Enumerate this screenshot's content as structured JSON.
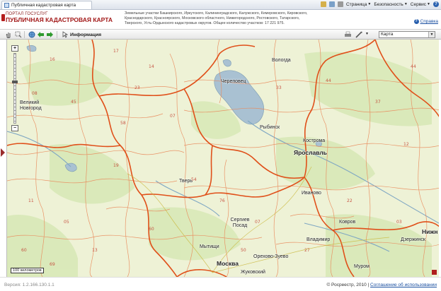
{
  "browser": {
    "tab_title": "Публичная кадастровая карта",
    "menu": [
      "Страница",
      "Безопасность",
      "Сервис"
    ]
  },
  "header": {
    "logo_top": "ПОРТАЛ ГОСУСЛУГ",
    "logo_title": "ПУБЛИЧНАЯ КАДАСТРОВАЯ КАРТА",
    "regions_text": "Земельные участки Башкирского, Иркутского, Калининградского, Калужского, Кемеровского, Кировского, Краснодарского, Красноярского, Московского областного, Нижегородского, Ростовского, Татарского, Тверского, Усть-Ордынского кадастровых округов. Общее количество участков: 17 221 975.",
    "help_label": "Справка"
  },
  "toolbar": {
    "info_label": "Информация",
    "layer_select": "Карта"
  },
  "map": {
    "cities": [
      {
        "name": "Череповец"
      },
      {
        "name": "Вологда"
      },
      {
        "name": "Рыбинск"
      },
      {
        "name": "Кострома"
      },
      {
        "name": "Ярославль"
      },
      {
        "name": "Иваново"
      },
      {
        "name": "Тверь"
      },
      {
        "name": "Владимир"
      },
      {
        "name": "Ковров"
      },
      {
        "name": "Сергиев Посад"
      },
      {
        "name": "Мытищи"
      },
      {
        "name": "Москва"
      },
      {
        "name": "Орехово-Зуево"
      },
      {
        "name": "Дзержинск"
      },
      {
        "name": "Муром"
      },
      {
        "name": "Великий Новгород"
      },
      {
        "name": "Нижн"
      },
      {
        "name": "Жуковский"
      }
    ],
    "scale_label": "100 километров"
  },
  "footer": {
    "version": "Версия: 1.2.166.130.1.1",
    "copyright": "© Росреестр, 2010 |",
    "terms_link": "Соглашение об использовании"
  },
  "colors": {
    "brand": "#a31a1a",
    "link": "#1a4fa0",
    "map_bg": "#eef2d6",
    "border": "#e4571c",
    "water": "#a9c1d2"
  }
}
